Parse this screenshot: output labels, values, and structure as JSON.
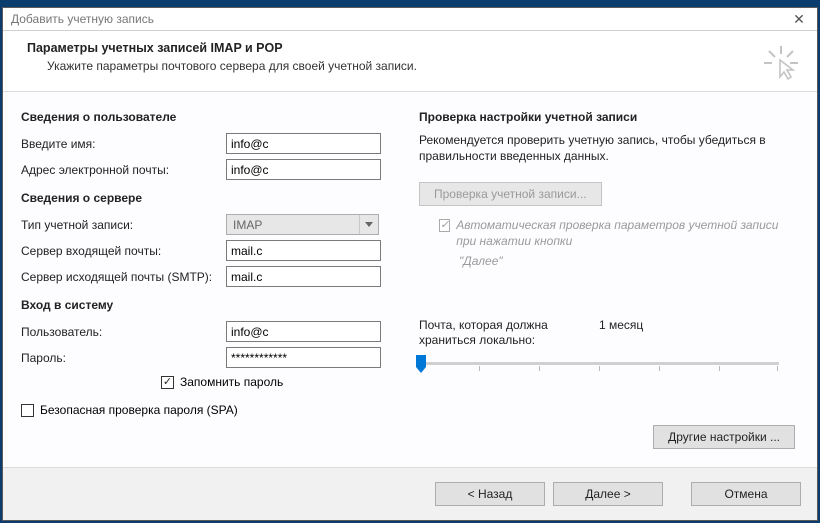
{
  "window": {
    "title": "Добавить учетную запись",
    "close_glyph": "✕"
  },
  "header": {
    "title": "Параметры учетных записей IMAP и POP",
    "subtitle": "Укажите параметры почтового сервера для своей учетной записи."
  },
  "left": {
    "user_section": "Сведения о пользователе",
    "name_label": "Введите имя:",
    "name_value": "info@c",
    "email_label": "Адрес электронной почты:",
    "email_value": "info@c",
    "server_section": "Сведения о сервере",
    "account_type_label": "Тип учетной записи:",
    "account_type_value": "IMAP",
    "incoming_label": "Сервер входящей почты:",
    "incoming_value": "mail.c",
    "outgoing_label": "Сервер исходящей почты (SMTP):",
    "outgoing_value": "mail.c",
    "login_section": "Вход в систему",
    "user_label": "Пользователь:",
    "user_value": "info@c",
    "pass_label": "Пароль:",
    "pass_value": "************",
    "remember_label": "Запомнить пароль",
    "spa_label": "Безопасная проверка пароля (SPA)"
  },
  "right": {
    "check_section": "Проверка настройки учетной записи",
    "recommendation": "Рекомендуется проверить учетную запись, чтобы убедиться в правильности введенных данных.",
    "check_button": "Проверка учетной записи...",
    "auto_check": "Автоматическая проверка параметров учетной записи при нажатии кнопки",
    "next_quote": "\"Далее\"",
    "slider_label": "Почта, которая должна храниться локально:",
    "slider_value": "1 месяц",
    "other_settings": "Другие настройки ..."
  },
  "footer": {
    "back": "< Назад",
    "next": "Далее >",
    "cancel": "Отмена"
  }
}
